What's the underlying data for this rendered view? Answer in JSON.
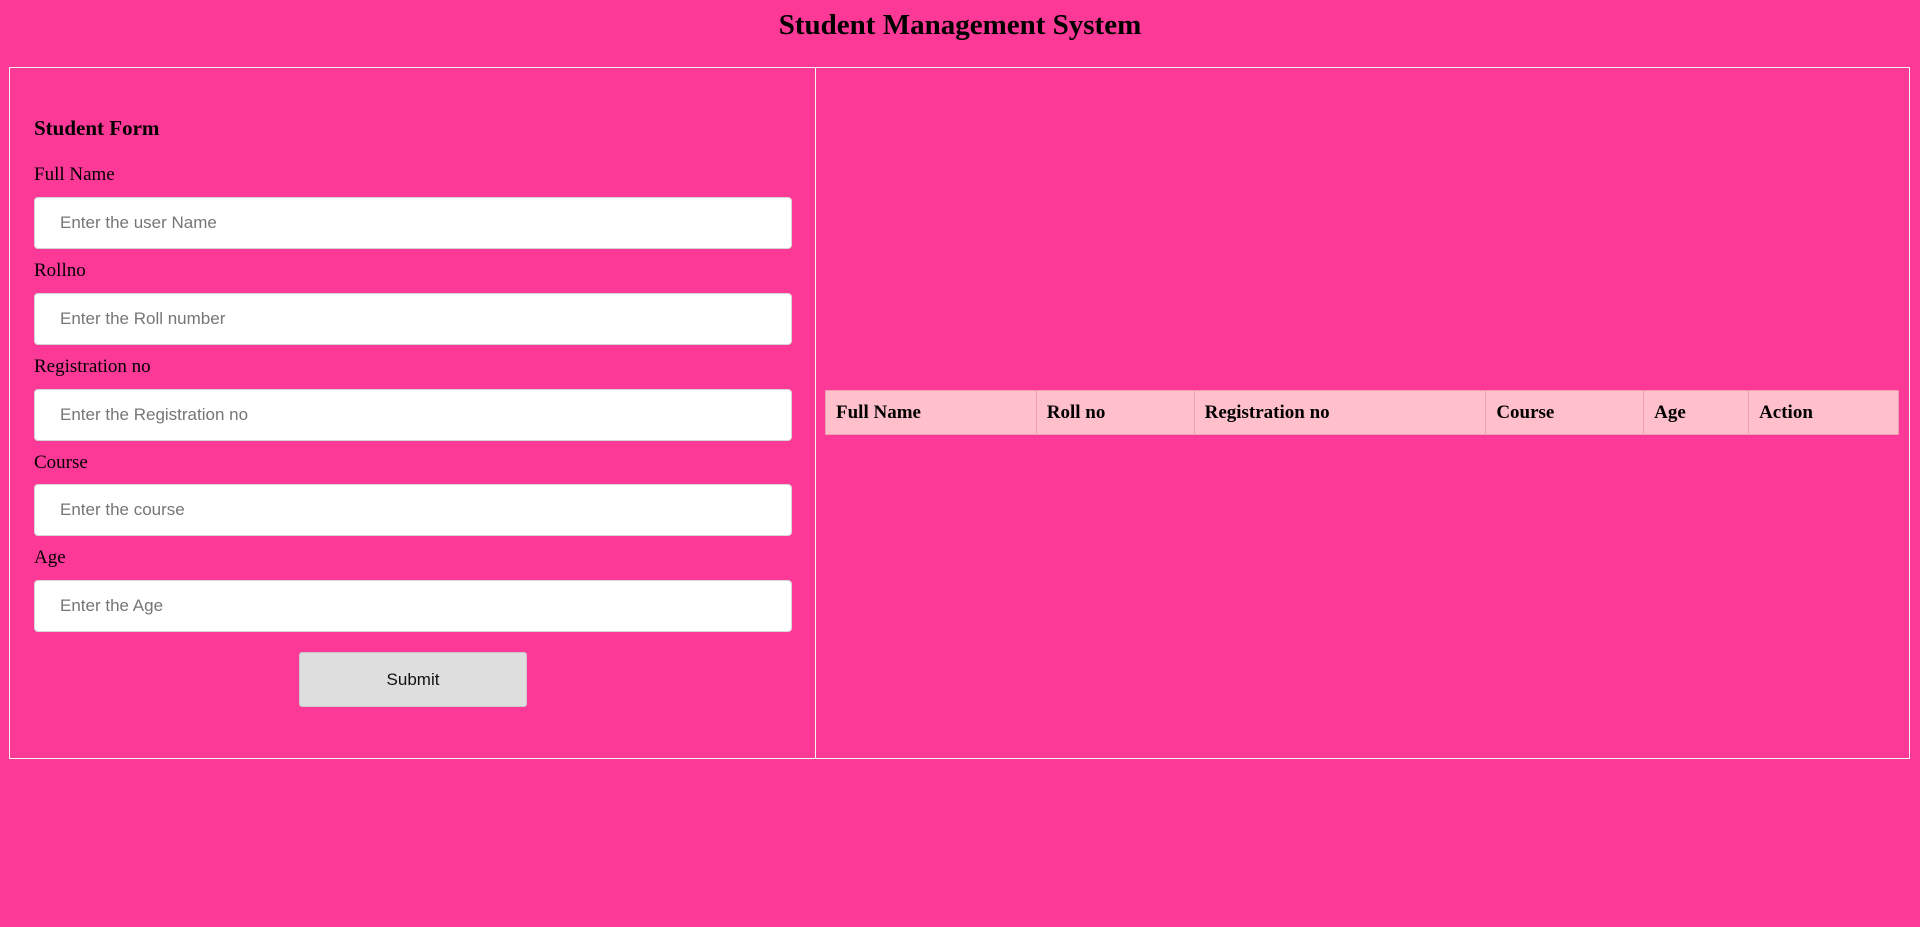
{
  "page": {
    "title": "Student Management System"
  },
  "form": {
    "heading": "Student Form",
    "fields": [
      {
        "label": "Full Name",
        "placeholder": "Enter the user Name",
        "value": ""
      },
      {
        "label": "Rollno",
        "placeholder": "Enter the Roll number",
        "value": ""
      },
      {
        "label": "Registration no",
        "placeholder": "Enter the Registration no",
        "value": ""
      },
      {
        "label": "Course",
        "placeholder": "Enter the course",
        "value": ""
      },
      {
        "label": "Age",
        "placeholder": "Enter the Age",
        "value": ""
      }
    ],
    "submit_label": "Submit"
  },
  "table": {
    "columns": [
      "Full Name",
      "Roll no",
      "Registration no",
      "Course",
      "Age",
      "Action"
    ],
    "rows": []
  },
  "colors": {
    "background": "#fc3997",
    "table_header": "#ffc0cb",
    "button": "#dedede"
  }
}
